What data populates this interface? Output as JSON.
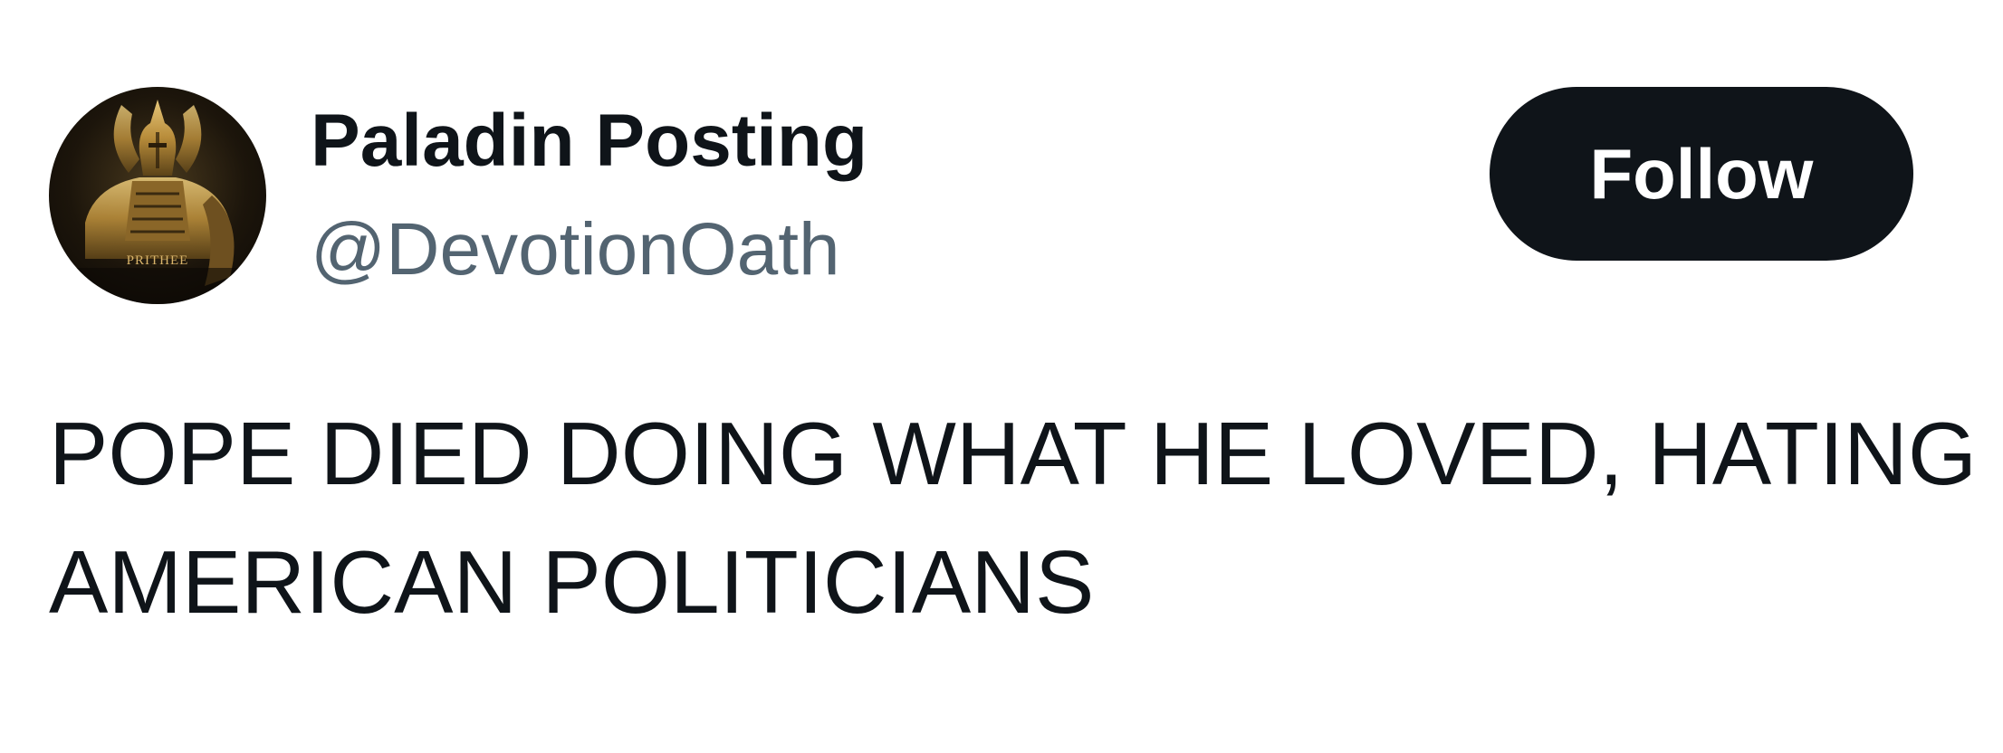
{
  "author": {
    "display_name": "Paladin Posting",
    "handle": "@DevotionOath",
    "avatar": {
      "icon": "armored-paladin-avatar",
      "caption": "PRITHEE"
    }
  },
  "actions": {
    "follow_label": "Follow"
  },
  "tweet": {
    "text_lines": [
      "POPE DIED DOING WHAT HE LOVED, HATING",
      "AMERICAN POLITICIANS"
    ]
  },
  "colors": {
    "text_primary": "#0f1419",
    "text_secondary": "#536471",
    "button_bg": "#0f1419",
    "button_text": "#ffffff",
    "avatar_gold": "#c9a24f"
  }
}
